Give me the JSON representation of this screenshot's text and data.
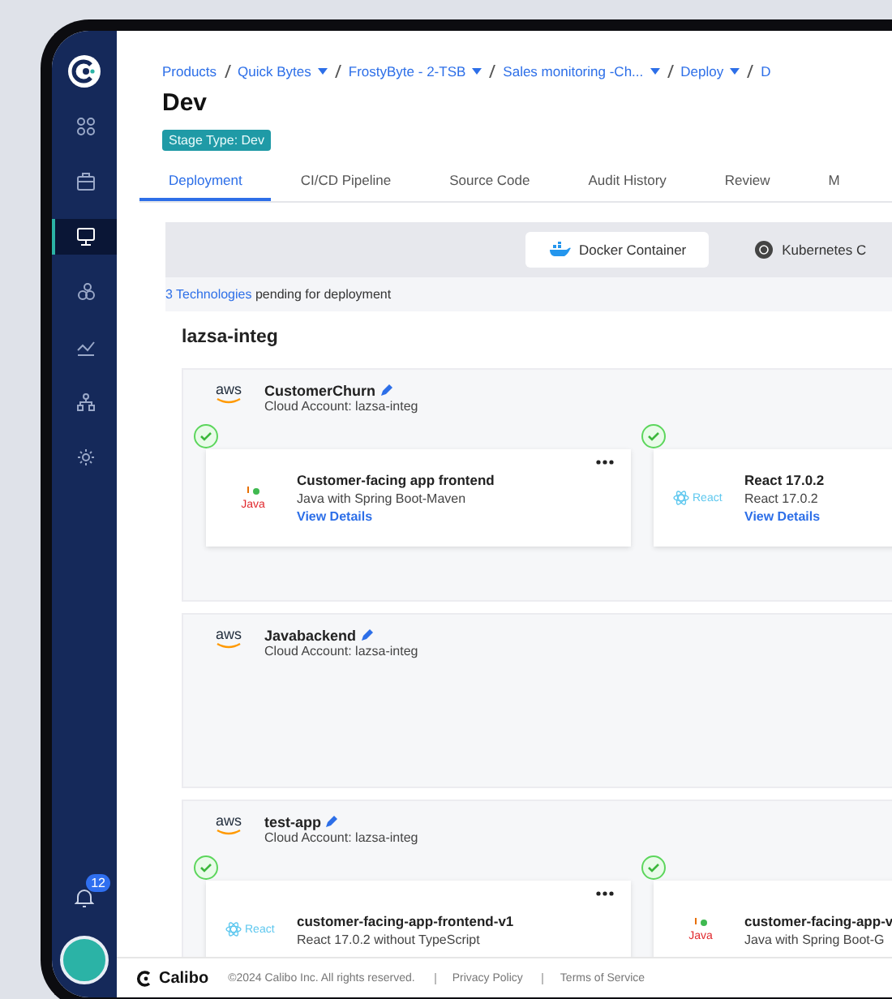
{
  "sidebar": {
    "items": [
      {
        "selected": false
      },
      {
        "selected": false
      },
      {
        "selected": true
      },
      {
        "selected": false
      },
      {
        "selected": false
      },
      {
        "selected": false
      },
      {
        "selected": false
      }
    ],
    "notifications": "12"
  },
  "breadcrumb": [
    {
      "label": "Products",
      "dropdown": false
    },
    {
      "label": "Quick Bytes",
      "dropdown": true
    },
    {
      "label": "FrostyByte - 2-TSB",
      "dropdown": true
    },
    {
      "label": "Sales monitoring -Ch...",
      "dropdown": true
    },
    {
      "label": "Deploy",
      "dropdown": true
    },
    {
      "label": "D",
      "dropdown": false
    }
  ],
  "page": {
    "title": "Dev",
    "badge": "Stage Type: Dev"
  },
  "tabs": [
    {
      "label": "Deployment",
      "selected": true
    },
    {
      "label": "CI/CD Pipeline",
      "selected": false
    },
    {
      "label": "Source Code",
      "selected": false
    },
    {
      "label": "Audit History",
      "selected": false
    },
    {
      "label": "Review",
      "selected": false
    },
    {
      "label": "M",
      "selected": false
    }
  ],
  "deploy_targets": [
    {
      "kind": "docker",
      "label": "Docker Container",
      "selected": true
    },
    {
      "kind": "kubernetes",
      "label": "Kubernetes C",
      "selected": false
    }
  ],
  "pending": {
    "count": "3 Technologies",
    "text": "pending for deployment"
  },
  "environment": {
    "name": "lazsa-integ",
    "apps": [
      {
        "provider": "aws",
        "name": "CustomerChurn",
        "account": "Cloud Account: lazsa-integ",
        "technologies": [
          {
            "kind": "java",
            "logo_label": "Java",
            "name": "Customer-facing app frontend",
            "description": "Java with Spring Boot-Maven",
            "link": "View Details",
            "deployed": true,
            "menu": true
          },
          {
            "kind": "react",
            "logo_label": "React",
            "name": "React 17.0.2",
            "description": "React 17.0.2",
            "link": "View Details",
            "deployed": true,
            "menu": false
          }
        ]
      },
      {
        "provider": "aws",
        "name": "Javabackend",
        "account": "Cloud Account: lazsa-integ"
      },
      {
        "provider": "aws",
        "name": "test-app",
        "account": "Cloud Account: lazsa-integ",
        "technologies": [
          {
            "kind": "react",
            "logo_label": "React",
            "name": "customer-facing-app-frontend-v1",
            "description": "React 17.0.2 without TypeScript",
            "deployed": true,
            "menu": true
          },
          {
            "kind": "java",
            "logo_label": "Java",
            "name": "customer-facing-app-v",
            "description": "Java with Spring Boot-G",
            "deployed": true,
            "menu": false
          }
        ]
      }
    ]
  },
  "footer": {
    "brand": "Calibo",
    "copyright": "©2024 Calibo Inc. All rights reserved.",
    "links": [
      "Privacy Policy",
      "Terms of Service"
    ]
  }
}
